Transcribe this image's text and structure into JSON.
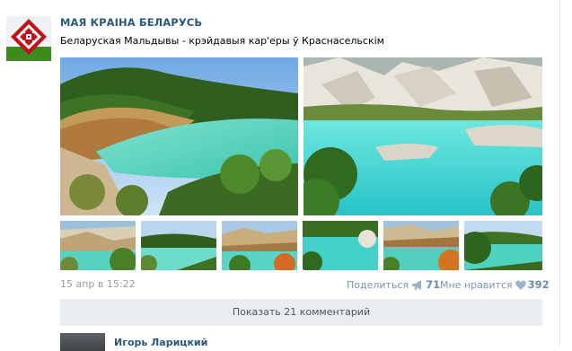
{
  "group": {
    "name": "МАЯ КРАІНА БЕЛАРУСЬ"
  },
  "post": {
    "text": "Беларуская Мальдывы - крэйдавыя кар'еры ў Краснасельскім",
    "date": "15 апр в 15:22",
    "share_label": "Поделиться",
    "share_count": "71",
    "like_label": "Мне нравится",
    "like_count": "392",
    "show_comments": "Показать 21 комментарий"
  },
  "comment": {
    "author": "Игорь Ларицкий"
  },
  "colors": {
    "link": "#2b587a",
    "meta": "#999999",
    "action": "#7895b1",
    "button_bg": "#e9edf1"
  }
}
